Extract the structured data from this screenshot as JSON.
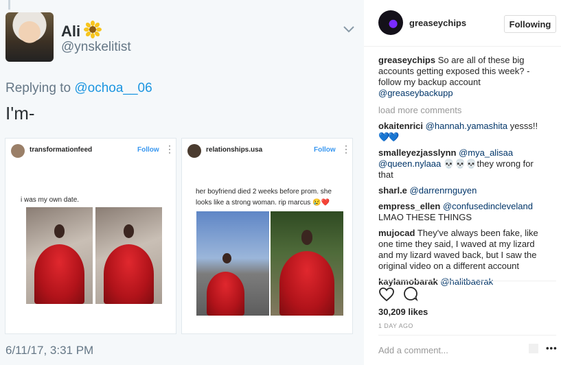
{
  "tweet": {
    "name": "Ali",
    "handle": "@ynskelitist",
    "replying_prefix": "Replying to ",
    "replying_to": "@ochoa__06",
    "text": "I'm-",
    "date": "6/11/17, 3:31 PM"
  },
  "panels": [
    {
      "user": "transformationfeed",
      "follow": "Follow",
      "caption": "i was my own date."
    },
    {
      "user": "relationships.usa",
      "follow": "Follow",
      "caption": "her boyfriend died 2 weeks before prom. she looks like a strong woman. rip marcus 😢❤️"
    }
  ],
  "instagram": {
    "username": "greaseychips",
    "follow_button": "Following",
    "caption": {
      "user": "greaseychips",
      "text": " So are all of these big accounts getting exposed this week? - follow my backup account ",
      "mention": "@greaseybackupp"
    },
    "load_more": "load more comments",
    "comments": [
      {
        "user": "okaitenrici",
        "mention": "@hannah.yamashita",
        "text": " yesss!!",
        "emoji": "💙💙"
      },
      {
        "user": "smalleyezjasslynn",
        "mention": "@mya_alisaa",
        "mention2": "@queen.nylaaa",
        "text": " 💀💀💀they wrong for that"
      },
      {
        "user": "sharl.e",
        "mention": "@darrenrnguyen",
        "text": ""
      },
      {
        "user": "empress_ellen",
        "mention": "@confusedincleveland",
        "text": "LMAO THESE THINGS"
      },
      {
        "user": "mujocad",
        "text": " They've always been fake, like one time they said, I waved at my lizard and my lizard waved back, but I saw the original video on a different account"
      },
      {
        "user": "kaylamobarak",
        "mention": "@halitbaerak",
        "text": ""
      }
    ],
    "likes": "30,209 likes",
    "time": "1 DAY AGO",
    "add_comment_placeholder": "Add a comment...",
    "more": "•••"
  },
  "colors": {
    "link": "#003569",
    "twitter_blue": "#1b95e0",
    "follow_blue": "#3897f0",
    "dress_red": "#c4161c"
  }
}
